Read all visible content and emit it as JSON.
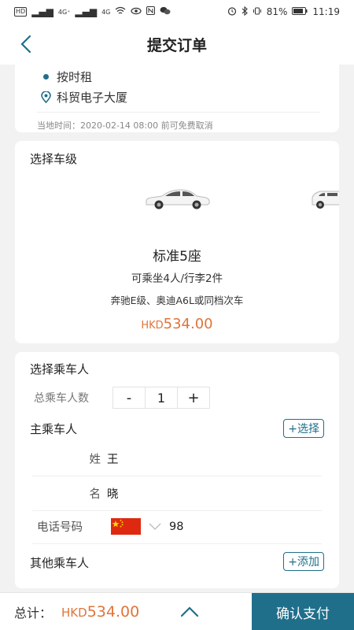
{
  "status_bar": {
    "carrier_tag": "HD",
    "signal_1": "4G⁺",
    "signal_2": "4G",
    "battery": "81%",
    "time": "11:19"
  },
  "header": {
    "title": "提交订单"
  },
  "route": {
    "service_type": "按时租",
    "location": "科贸电子大厦",
    "cancel_note": "当地时间：2020-02-14 08:00 前可免费取消"
  },
  "car_level": {
    "section_title": "选择车级",
    "name": "标准5座",
    "capacity": "可乘坐4人/行李2件",
    "models": "奔驰E级、奥迪A6L或同档次车",
    "price_currency": "HKD",
    "price_amount": "534.00"
  },
  "passenger": {
    "section_title": "选择乘车人",
    "count_label": "总乘车人数",
    "minus": "-",
    "count": "1",
    "plus": "+",
    "main_label": "主乘车人",
    "select_button": "+选择",
    "surname_label": "姓",
    "surname_value": "王",
    "given_name_label": "名",
    "given_name_value": "晓",
    "phone_label": "电话号码",
    "phone_value": "98",
    "others_label": "其他乘车人",
    "add_button": "+添加"
  },
  "bottom": {
    "total_label": "总计：",
    "total_currency": "HKD",
    "total_amount": "534.00",
    "confirm_button": "确认支付"
  },
  "colors": {
    "accent": "#1f6f8b",
    "price": "#e0743a",
    "background": "#f2f2f2"
  },
  "icons": {
    "back": "chevron-left-icon",
    "location": "map-pin-icon",
    "flag": "china-flag-icon",
    "dropdown": "chevron-down-icon",
    "expand": "chevron-up-icon"
  }
}
